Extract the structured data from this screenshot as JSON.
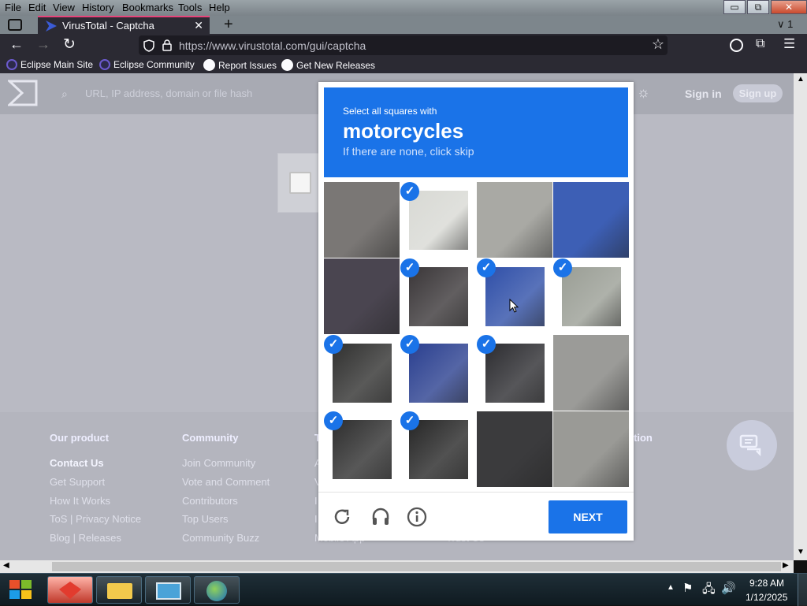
{
  "menu": {
    "file": "File",
    "edit": "Edit",
    "view": "View",
    "history": "History",
    "bookmarks": "Bookmarks",
    "tools": "Tools",
    "help": "Help"
  },
  "window": {
    "min": "▭",
    "restore": "⧉",
    "close": "✕"
  },
  "tab": {
    "title": "VirusTotal - Captcha",
    "close": "✕",
    "new_tab": "+",
    "list_indicator": "1"
  },
  "nav": {
    "url": "https://www.virustotal.com/gui/captcha"
  },
  "bookmarks": [
    "Eclipse Main Site",
    "Eclipse Community",
    "Report Issues",
    "Get New Releases"
  ],
  "vt": {
    "search_placeholder": "URL, IP address, domain or file hash",
    "sign_in": "Sign in",
    "sign_up": "Sign up"
  },
  "footer": {
    "col1_title": "Our product",
    "col2_title": "Community",
    "col3_title_visible": "T",
    "col5_title_visible": "tion",
    "col1": [
      "Contact Us",
      "Get Support",
      "How It Works",
      "ToS | Privacy Notice",
      "Blog | Releases"
    ],
    "col2": [
      "Join Community",
      "Vote and Comment",
      "Contributors",
      "Top Users",
      "Community Buzz"
    ],
    "col3_partial": [
      "A",
      "V",
      "I",
      "I",
      "Mobile App"
    ],
    "col4_partial": [
      "",
      "",
      "",
      "",
      "Trust Us"
    ]
  },
  "captcha": {
    "intro": "Select all squares with",
    "target": "motorcycles",
    "hint": "If there are none, click skip",
    "next": "NEXT",
    "check": "✓",
    "tiles": [
      {
        "selected": false,
        "color": "#7a7775"
      },
      {
        "selected": true,
        "color": "#d8d9d4"
      },
      {
        "selected": false,
        "color": "#a9a9a4"
      },
      {
        "selected": false,
        "color": "#3d5fb5"
      },
      {
        "selected": false,
        "color": "#4a4550"
      },
      {
        "selected": true,
        "color": "#3a3638"
      },
      {
        "selected": true,
        "color": "#2f4fa8"
      },
      {
        "selected": true,
        "color": "#9a9e95"
      },
      {
        "selected": true,
        "color": "#30302f"
      },
      {
        "selected": true,
        "color": "#2a3f8f"
      },
      {
        "selected": true,
        "color": "#2c2c30"
      },
      {
        "selected": false,
        "color": "#9b9b98"
      },
      {
        "selected": true,
        "color": "#2e2e2e"
      },
      {
        "selected": true,
        "color": "#262626"
      },
      {
        "selected": false,
        "color": "#3b3b3d"
      },
      {
        "selected": false,
        "color": "#9a9a96"
      }
    ]
  },
  "clock": {
    "time": "9:28 AM",
    "date": "1/12/2025"
  },
  "colors": {
    "accent": "#1a73e8",
    "browser_chrome": "#2b2a33"
  }
}
